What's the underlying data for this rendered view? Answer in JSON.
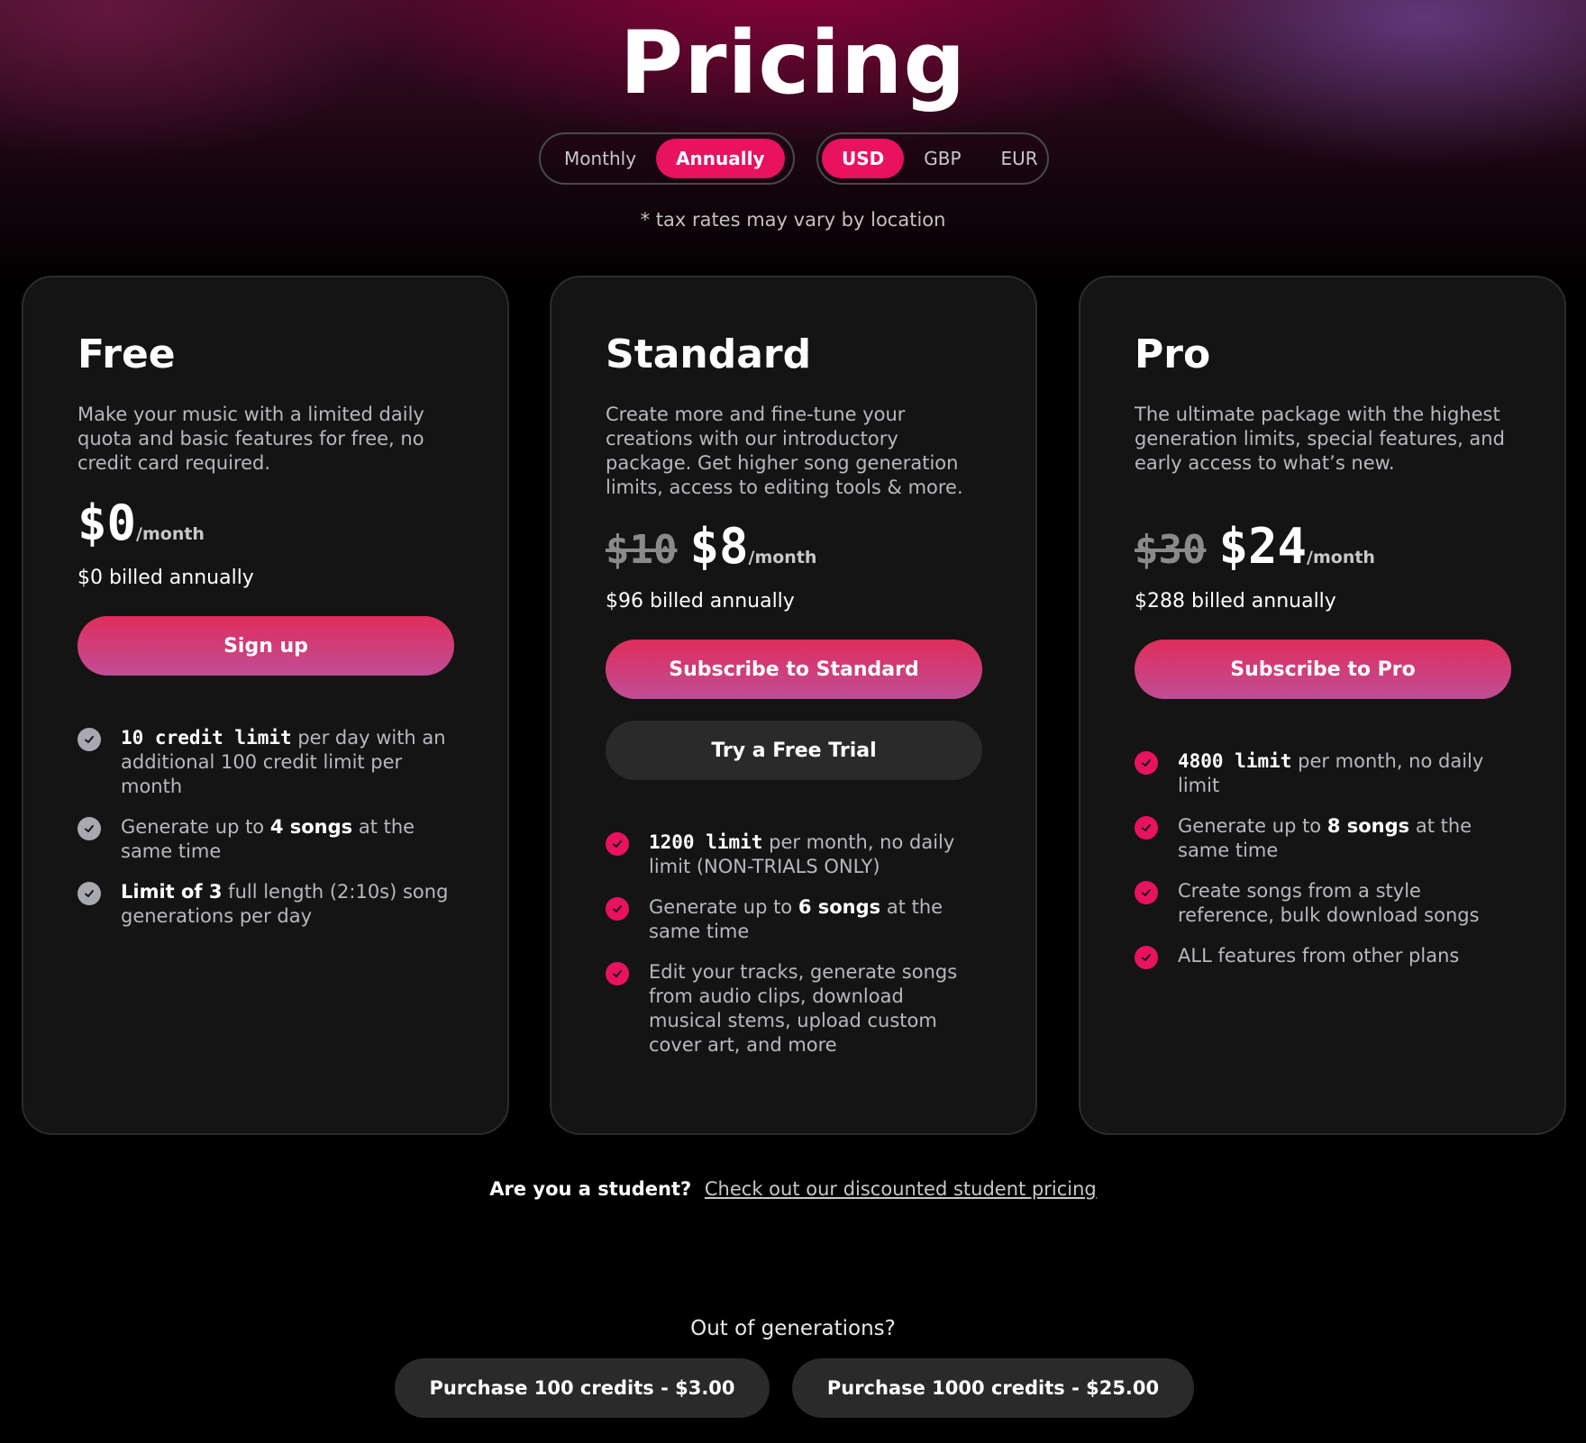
{
  "header": {
    "title": "Pricing",
    "billing_toggle": {
      "monthly": "Monthly",
      "annually": "Annually",
      "selected": "Annually"
    },
    "currency_toggle": {
      "usd": "USD",
      "gbp": "GBP",
      "eur": "EUR",
      "selected": "USD"
    },
    "tax_note": "* tax rates may vary by location"
  },
  "plans": {
    "free": {
      "name": "Free",
      "description": "Make your music with a limited daily quota and basic features for free, no credit card required.",
      "price": "$0",
      "per": "/month",
      "billed": "$0 billed annually",
      "cta": "Sign up",
      "features": [
        {
          "bold": "10 credit limit",
          "rest": " per day with an additional 100 credit limit per month"
        },
        {
          "pre": "Generate up to ",
          "bold": "4 songs",
          "rest": " at the same time"
        },
        {
          "bold": "Limit of 3",
          "rest": " full length (2:10s) song generations per day"
        }
      ]
    },
    "standard": {
      "name": "Standard",
      "description": "Create more and fine-tune your creations with our introductory package. Get higher song generation limits, access to editing tools & more.",
      "old_price": "$10",
      "price": "$8",
      "per": "/month",
      "billed": "$96 billed annually",
      "cta": "Subscribe to Standard",
      "secondary_cta": "Try a Free Trial",
      "features": [
        {
          "bold": "1200 limit",
          "rest": " per month, no daily limit (NON-TRIALS ONLY)"
        },
        {
          "pre": "Generate up to ",
          "bold": "6 songs",
          "rest": " at the same time"
        },
        {
          "rest": "Edit your tracks, generate songs from audio clips, download musical stems, upload custom cover art, and more"
        }
      ]
    },
    "pro": {
      "name": "Pro",
      "description": "The ultimate package with the highest generation limits, special features, and early access to what’s new.",
      "old_price": "$30",
      "price": "$24",
      "per": "/month",
      "billed": "$288 billed annually",
      "cta": "Subscribe to Pro",
      "features": [
        {
          "bold": "4800 limit",
          "rest": " per month, no daily limit"
        },
        {
          "pre": "Generate up to ",
          "bold": "8 songs",
          "rest": " at the same time"
        },
        {
          "rest": "Create songs from a style reference, bulk download songs"
        },
        {
          "rest": "ALL features from other plans"
        }
      ]
    }
  },
  "student": {
    "question": "Are you a student?",
    "link": "Check out our discounted student pricing"
  },
  "credits": {
    "title": "Out of generations?",
    "buy_100": "Purchase 100 credits - $3.00",
    "buy_1000": "Purchase 1000 credits - $25.00"
  },
  "colors": {
    "accent": "#e8125f",
    "card_bg": "#141414",
    "check_free": "#a8a8b0"
  }
}
